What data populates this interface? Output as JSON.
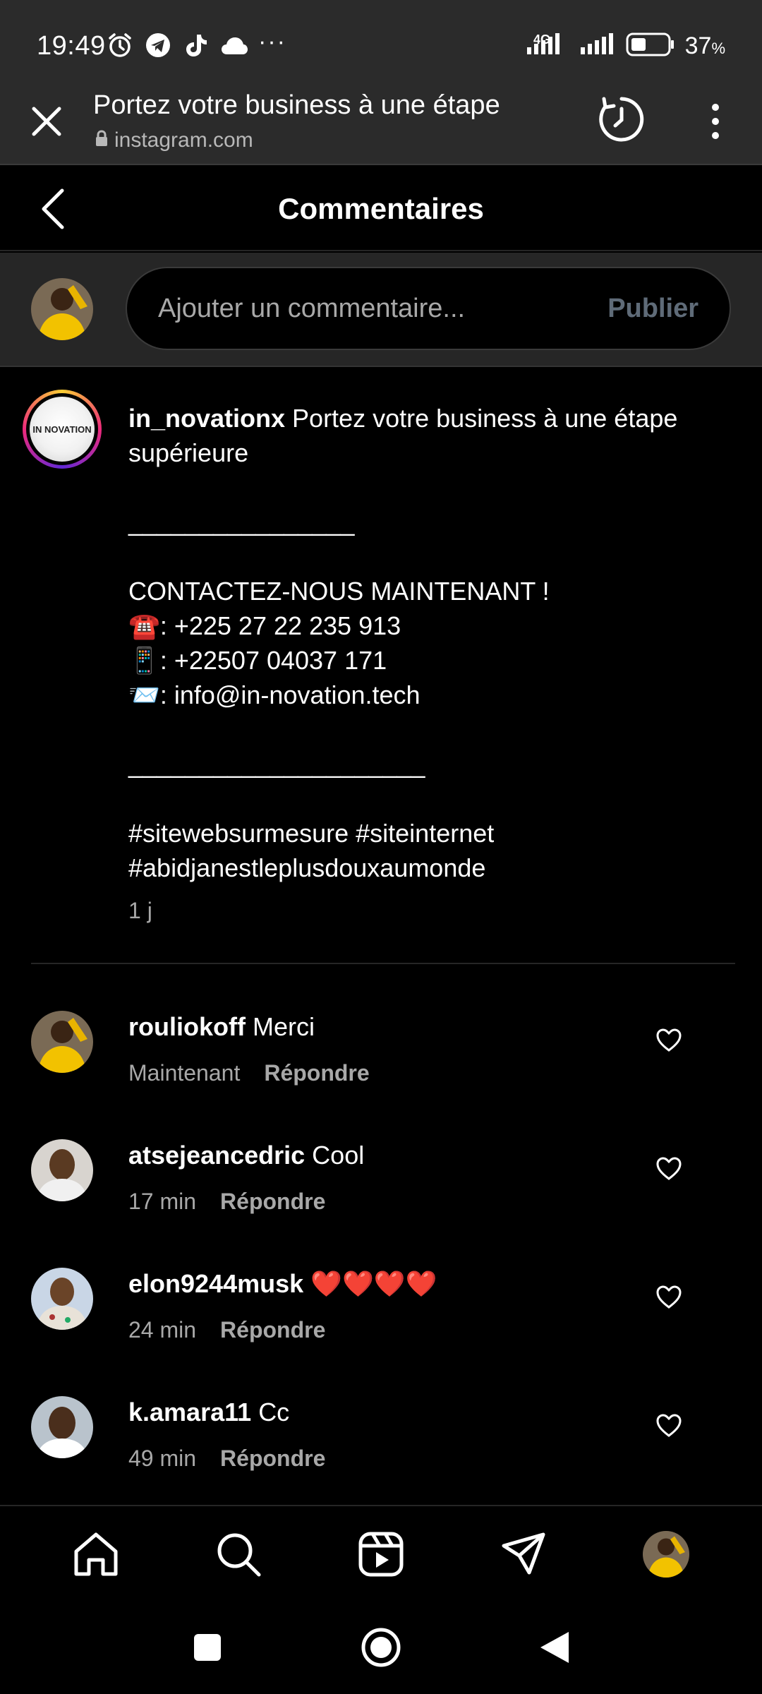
{
  "status_bar": {
    "time": "19:49",
    "icons_left": [
      "alarm-icon",
      "telegram-icon",
      "tiktok-icon",
      "cloud-icon"
    ],
    "more": "···",
    "network": "4G",
    "battery_percent": "37",
    "percent_sign": "%"
  },
  "browser": {
    "title": "Portez votre business à une étape",
    "url": "instagram.com"
  },
  "header": {
    "title": "Commentaires"
  },
  "composer": {
    "placeholder": "Ajouter un commentaire...",
    "publish_label": "Publier"
  },
  "caption": {
    "username": "in_novationx",
    "lines": [
      " Portez votre business à une étape",
      "supérieure",
      "",
      "________________",
      "",
      "CONTACTEZ-NOUS MAINTENANT !",
      "☎️: +225 27 22 235 913",
      "📱: +22507 04037 171",
      "📨: info@in-novation.tech",
      "",
      "_____________________",
      "",
      "#sitewebsurmesure #siteinternet",
      "#abidjanestleplusdouxaumonde"
    ],
    "time": "1 j",
    "logo_text": "IN NOVATION"
  },
  "comments": [
    {
      "username": "rouliokoff",
      "text": "Merci",
      "time": "Maintenant",
      "reply": "Répondre"
    },
    {
      "username": "atsejeancedric",
      "text": "Cool",
      "time": "17 min",
      "reply": "Répondre"
    },
    {
      "username": "elon9244musk",
      "text": "❤️❤️❤️❤️",
      "time": "24 min",
      "reply": "Répondre"
    },
    {
      "username": "k.amara11",
      "text": "Cc",
      "time": "49 min",
      "reply": "Répondre"
    }
  ],
  "colors": {
    "background": "#000000",
    "chrome": "#2b2b2b",
    "muted_text": "#a8a8a8",
    "publish_disabled": "#5f6b78",
    "heart_red": "#ff3040"
  }
}
